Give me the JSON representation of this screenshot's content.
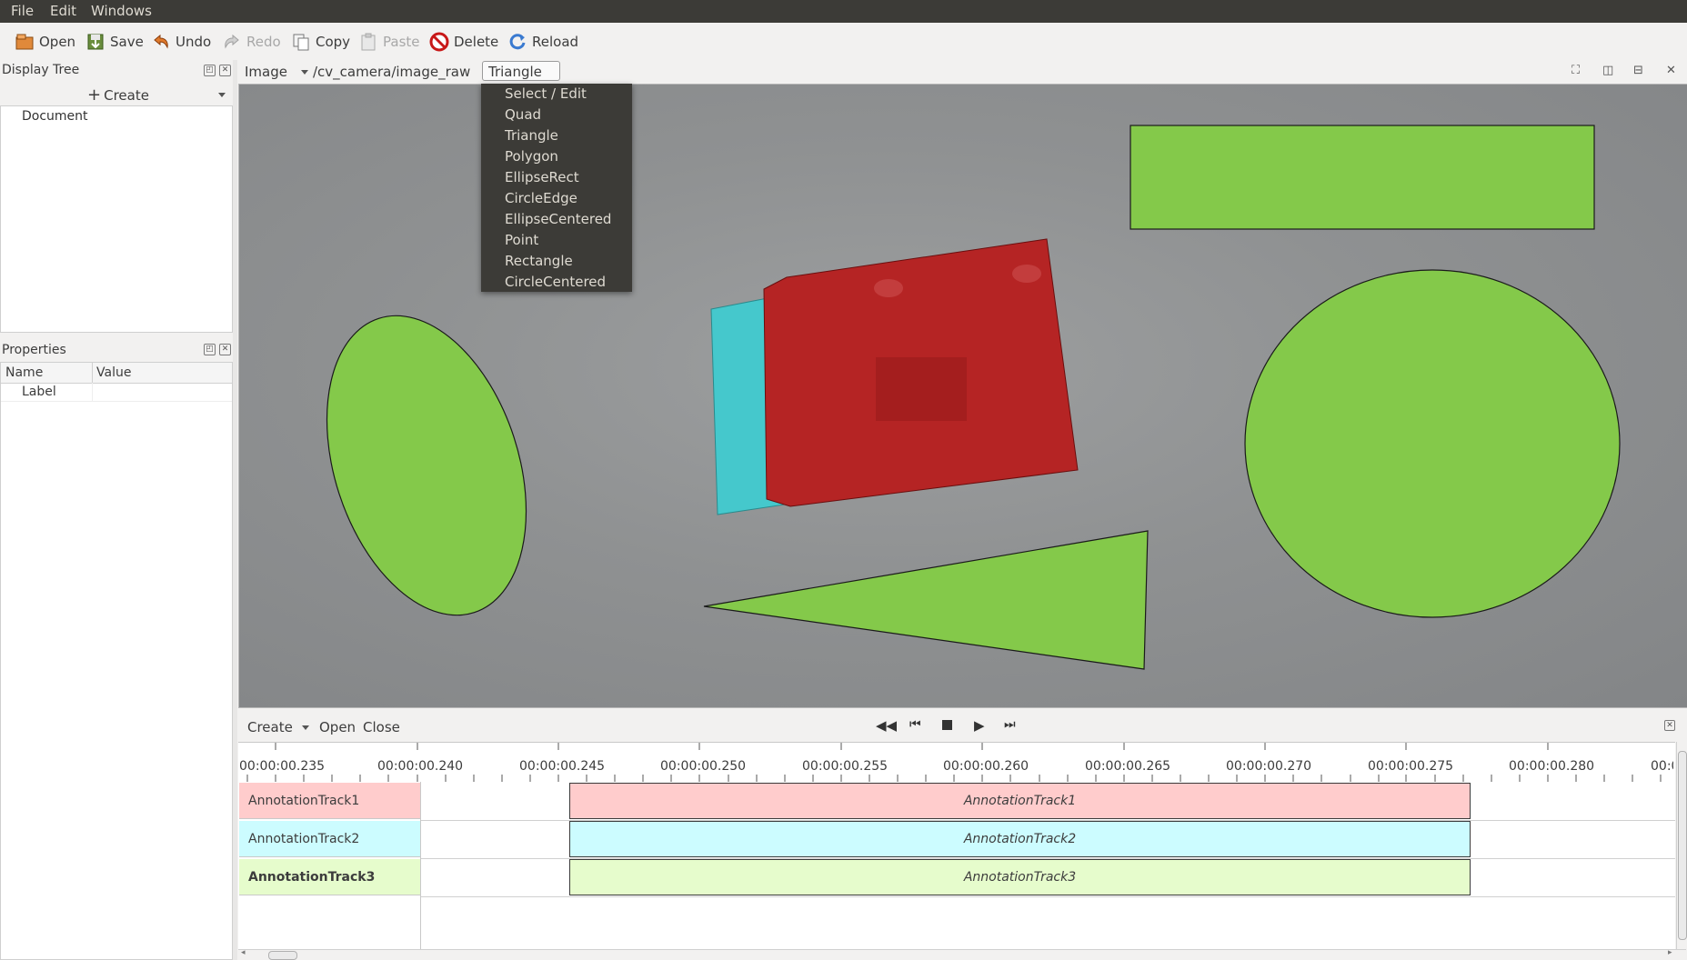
{
  "menubar": {
    "items": [
      "File",
      "Edit",
      "Windows"
    ]
  },
  "toolbar": {
    "open": "Open",
    "save": "Save",
    "undo": "Undo",
    "redo": "Redo",
    "copy": "Copy",
    "paste": "Paste",
    "delete": "Delete",
    "reload": "Reload"
  },
  "display_tree": {
    "title": "Display Tree",
    "create_label": "Create",
    "items": [
      "Document"
    ]
  },
  "properties": {
    "title": "Properties",
    "columns": [
      "Name",
      "Value"
    ],
    "rows": [
      {
        "name": "Label",
        "value": ""
      }
    ]
  },
  "view_toolbar": {
    "display_type": "Image",
    "topic": "/cv_camera/image_raw",
    "shape_tool": "Triangle"
  },
  "shape_menu": {
    "options": [
      "Select / Edit",
      "Quad",
      "Triangle",
      "Polygon",
      "EllipseRect",
      "CircleEdge",
      "EllipseCentered",
      "Point",
      "Rectangle",
      "CircleCentered"
    ]
  },
  "annotation_colors": {
    "green": "#84c94a",
    "red": "#b52424",
    "cyan": "#45c8cc"
  },
  "timeline": {
    "create": "Create",
    "open": "Open",
    "close": "Close",
    "ruler": [
      "00:00:00.235",
      "00:00:00.240",
      "00:00:00.245",
      "00:00:00.250",
      "00:00:00.255",
      "00:00:00.260",
      "00:00:00.265",
      "00:00:00.270",
      "00:00:00.275",
      "00:00:00.280",
      "00:00:0"
    ],
    "tracks": [
      {
        "name": "AnnotationTrack1",
        "bar_label": "AnnotationTrack1",
        "color": "#ffcccc"
      },
      {
        "name": "AnnotationTrack2",
        "bar_label": "AnnotationTrack2",
        "color": "#ccfcff"
      },
      {
        "name": "AnnotationTrack3",
        "bar_label": "AnnotationTrack3",
        "color": "#e6fccc"
      }
    ]
  }
}
